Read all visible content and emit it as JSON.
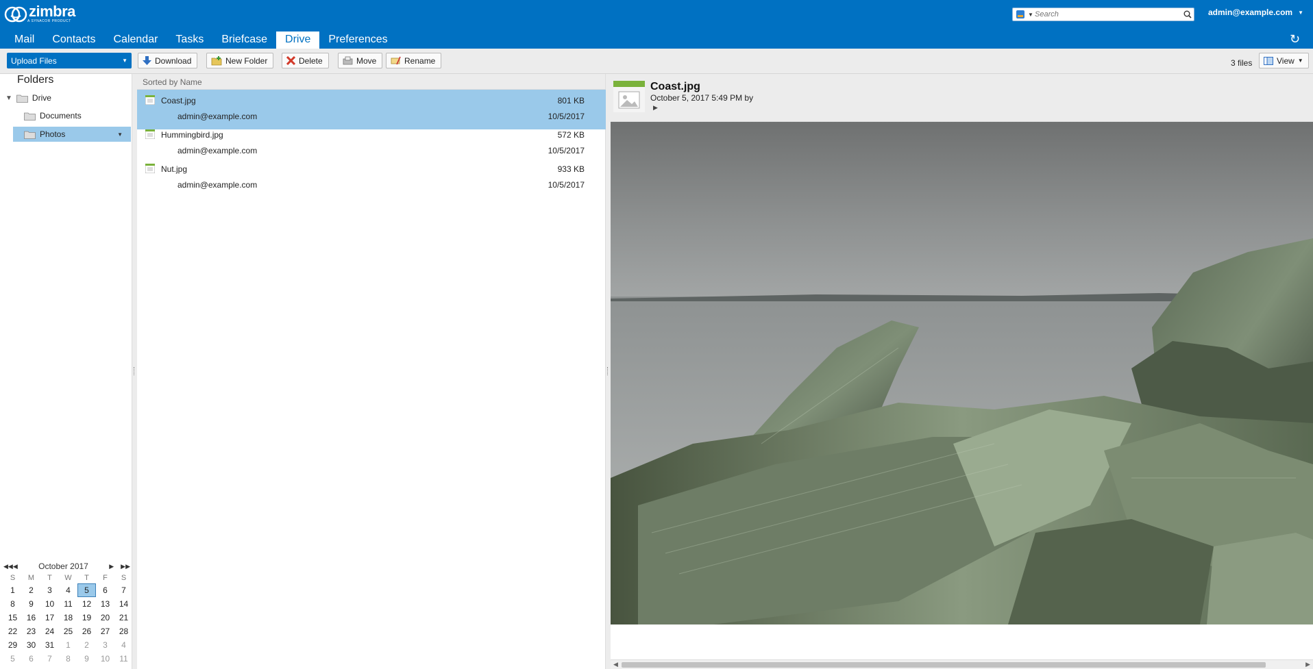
{
  "header": {
    "brand": "zimbra",
    "tagline": "A SYNACOR PRODUCT",
    "search_placeholder": "Search",
    "user": "admin@example.com",
    "tabs": [
      {
        "label": "Mail"
      },
      {
        "label": "Contacts"
      },
      {
        "label": "Calendar"
      },
      {
        "label": "Tasks"
      },
      {
        "label": "Briefcase"
      },
      {
        "label": "Drive",
        "active": true
      },
      {
        "label": "Preferences"
      }
    ]
  },
  "toolbar": {
    "upload_label": "Upload Files",
    "download_label": "Download",
    "new_folder_label": "New Folder",
    "delete_label": "Delete",
    "move_label": "Move",
    "rename_label": "Rename",
    "files_count": "3 files",
    "view_label": "View"
  },
  "sidebar": {
    "heading": "Folders",
    "tree": [
      {
        "label": "Drive"
      },
      {
        "label": "Documents"
      },
      {
        "label": "Photos",
        "selected": true
      }
    ]
  },
  "calendar": {
    "month": "October 2017",
    "weekdays": [
      "S",
      "M",
      "T",
      "W",
      "T",
      "F",
      "S"
    ],
    "days": [
      "1",
      "2",
      "3",
      "4",
      "5",
      "6",
      "7",
      "8",
      "9",
      "10",
      "11",
      "12",
      "13",
      "14",
      "15",
      "16",
      "17",
      "18",
      "19",
      "20",
      "21",
      "22",
      "23",
      "24",
      "25",
      "26",
      "27",
      "28",
      "29",
      "30",
      "31",
      "1",
      "2",
      "3",
      "4",
      "5",
      "6",
      "7",
      "8",
      "9",
      "10",
      "11"
    ],
    "today": "5"
  },
  "list": {
    "sort_header": "Sorted by Name",
    "files": [
      {
        "name": "Coast.jpg",
        "owner": "admin@example.com",
        "size": "801 KB",
        "date": "10/5/2017",
        "selected": true
      },
      {
        "name": "Hummingbird.jpg",
        "owner": "admin@example.com",
        "size": "572 KB",
        "date": "10/5/2017"
      },
      {
        "name": "Nut.jpg",
        "owner": "admin@example.com",
        "size": "933 KB",
        "date": "10/5/2017"
      }
    ]
  },
  "preview": {
    "title": "Coast.jpg",
    "meta": "October 5, 2017 5:49 PM by"
  },
  "colors": {
    "header_bg": "#0071c2",
    "selection": "#9ac9ea",
    "file_tag": "#7ab23b"
  }
}
